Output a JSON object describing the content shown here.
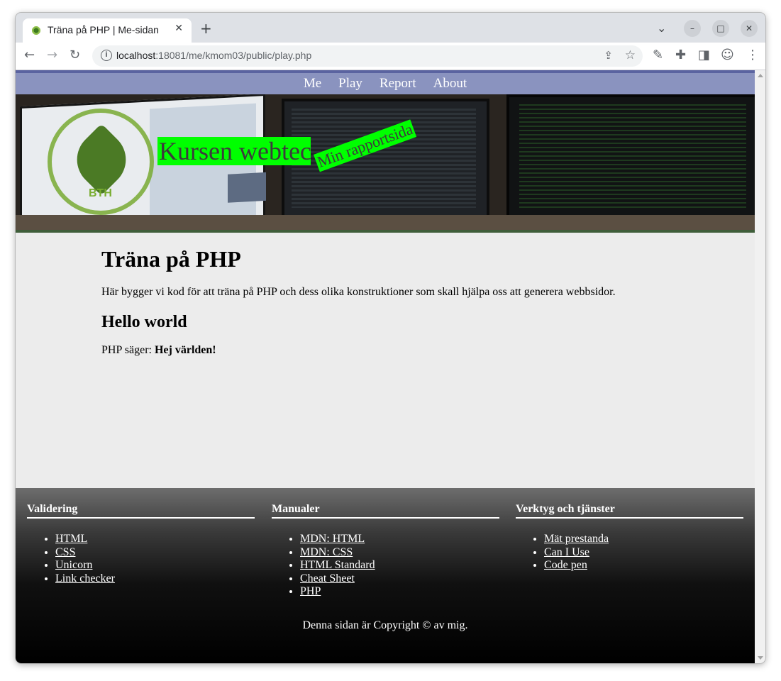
{
  "browser": {
    "tab_title": "Träna på PHP | Me-sidan",
    "tab_close": "✕",
    "new_tab": "+",
    "url_host": "localhost",
    "url_rest": ":18081/me/kmom03/public/play.php",
    "icons": [
      "back-icon",
      "forward-icon",
      "reload-icon",
      "info-icon",
      "share-icon",
      "star-icon",
      "eyedropper-icon",
      "extensions-icon",
      "sidepanel-icon",
      "profile-icon",
      "menu-icon"
    ],
    "win_minimize": "–",
    "win_maximize": "□",
    "win_close": "✕"
  },
  "nav": {
    "items": [
      "Me",
      "Play",
      "Report",
      "About"
    ]
  },
  "header": {
    "site_title": "Kursen webtec",
    "site_slogan": "Min rapportsida",
    "logo_text": "BTH"
  },
  "main": {
    "title": "Träna på PHP",
    "intro": "Här bygger vi kod för att träna på PHP och dess olika konstruktioner som skall hjälpa oss att generera webbsidor.",
    "hello_heading": "Hello world",
    "php_says_label": "PHP säger:",
    "php_says_value": "Hej världen!"
  },
  "footer": {
    "columns": [
      {
        "heading": "Validering",
        "links": [
          "HTML",
          "CSS",
          "Unicorn",
          "Link checker"
        ]
      },
      {
        "heading": "Manualer",
        "links": [
          "MDN: HTML",
          "MDN: CSS",
          "HTML Standard",
          "Cheat Sheet",
          "PHP"
        ]
      },
      {
        "heading": "Verktyg och tjänster",
        "links": [
          "Mät prestanda",
          "Can I Use",
          "Code pen"
        ]
      }
    ],
    "copyright": "Denna sidan är Copyright © av mig."
  },
  "colors": {
    "nav_bg": "#8a93bf",
    "title_highlight": "#00ff00",
    "page_bg": "#ececec",
    "footer_bottom": "#000000"
  }
}
